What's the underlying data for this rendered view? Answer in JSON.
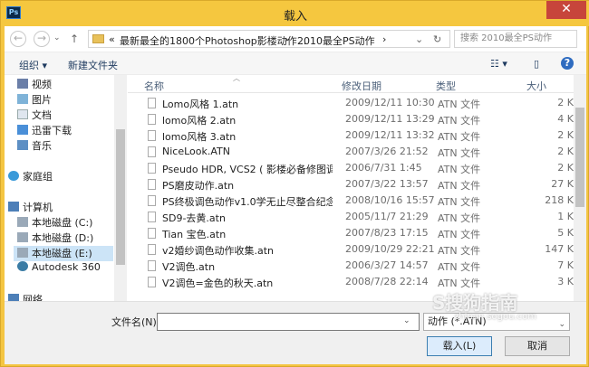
{
  "window": {
    "title": "载入",
    "app_icon": "Ps",
    "close_symbol": "✕"
  },
  "nav": {
    "back": "←",
    "forward": "→",
    "up": "↑",
    "crumbs": [
      "«",
      "最新最全的1800个Photoshop影楼动作...",
      "›",
      "2010最全PS动作",
      "›"
    ],
    "dropdown": "⌄",
    "refresh": "↻",
    "search_placeholder": "搜索 2010最全PS动作"
  },
  "toolbar": {
    "organize": "组织 ▾",
    "new_folder": "新建文件夹",
    "view": "☷ ▾",
    "pane": "▯",
    "help": "?"
  },
  "sidebar": {
    "items": [
      {
        "label": "视频"
      },
      {
        "label": "图片"
      },
      {
        "label": "文档"
      },
      {
        "label": "迅雷下载"
      },
      {
        "label": "音乐"
      },
      {
        "label": "家庭组"
      },
      {
        "label": "计算机"
      },
      {
        "label": "本地磁盘 (C:)"
      },
      {
        "label": "本地磁盘 (D:)"
      },
      {
        "label": "本地磁盘 (E:)"
      },
      {
        "label": "Autodesk 360"
      },
      {
        "label": "网络"
      }
    ]
  },
  "list": {
    "headers": {
      "name": "名称",
      "date": "修改日期",
      "type": "类型",
      "size": "大小"
    },
    "rows": [
      {
        "name": "Lomo风格 1.atn",
        "date": "2009/12/11 10:30",
        "type": "ATN 文件",
        "size": "2 K"
      },
      {
        "name": "lomo风格 2.atn",
        "date": "2009/12/11 13:29",
        "type": "ATN 文件",
        "size": "4 K"
      },
      {
        "name": "lomo风格 3.atn",
        "date": "2009/12/11 13:32",
        "type": "ATN 文件",
        "size": "2 K"
      },
      {
        "name": "NiceLook.ATN",
        "date": "2007/3/26 21:52",
        "type": "ATN 文件",
        "size": "2 K"
      },
      {
        "name": "Pseudo HDR, VCS2 ( 影楼必备修图调...",
        "date": "2006/7/31 1:45",
        "type": "ATN 文件",
        "size": "2 K"
      },
      {
        "name": "PS磨皮动作.atn",
        "date": "2007/3/22 13:57",
        "type": "ATN 文件",
        "size": "27 K"
      },
      {
        "name": "PS终极调色动作v1.0学无止尽整合纪念...",
        "date": "2008/10/16 15:57",
        "type": "ATN 文件",
        "size": "218 K"
      },
      {
        "name": "SD9-去黄.atn",
        "date": "2005/11/7 21:29",
        "type": "ATN 文件",
        "size": "1 K"
      },
      {
        "name": "Tian 宝色.atn",
        "date": "2007/8/23 17:15",
        "type": "ATN 文件",
        "size": "5 K"
      },
      {
        "name": "v2婚纱调色动作收集.atn",
        "date": "2009/10/29 22:21",
        "type": "ATN 文件",
        "size": "147 K"
      },
      {
        "name": "V2调色.atn",
        "date": "2006/3/27 14:57",
        "type": "ATN 文件",
        "size": "7 K"
      },
      {
        "name": "V2调色=金色的秋天.atn",
        "date": "2008/7/28 22:14",
        "type": "ATN 文件",
        "size": "3 K"
      }
    ]
  },
  "bottom": {
    "filename_label": "文件名(N):",
    "filename_value": "",
    "filetype": "动作 (*.ATN)",
    "load": "载入(L)",
    "cancel": "取消"
  },
  "watermark": {
    "main": "S搜狗指南",
    "sub": "zhinan.sogou.com"
  },
  "colors": {
    "titlebar": "#f5c73f",
    "close": "#c7453b",
    "selection": "#cce4f7"
  }
}
